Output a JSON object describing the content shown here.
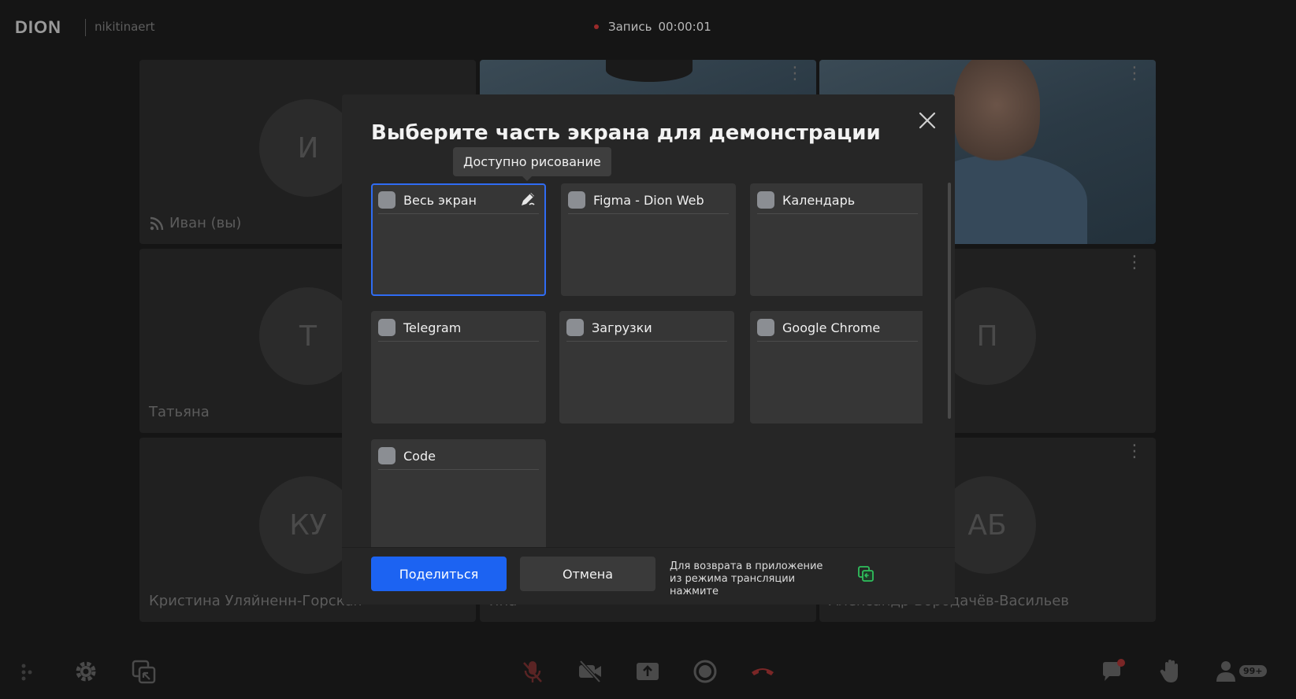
{
  "header": {
    "logo": "DION",
    "username": "nikitinaert",
    "record_label": "Запись",
    "record_time": "00:00:01"
  },
  "tiles": [
    {
      "initials": "И",
      "name": "Иван (вы)"
    },
    {
      "initials": "Т",
      "name": "Татьяна"
    },
    {
      "initials": "КУ",
      "name": "Кристина Уляйненн-Горская"
    },
    {
      "initials": "П",
      "name": ""
    },
    {
      "initials": "АБ",
      "name": "Александр Бородачёв-Васильев"
    },
    {
      "initials": "",
      "name": "Яна"
    }
  ],
  "modal": {
    "title": "Выберите часть экрана для демонстрации",
    "tooltip": "Доступно рисование",
    "sources": [
      {
        "label": "Весь экран",
        "selected": true
      },
      {
        "label": "Figma - Dion Web"
      },
      {
        "label": "Календарь"
      },
      {
        "label": "Telegram"
      },
      {
        "label": "Загрузки"
      },
      {
        "label": "Google Chrome"
      },
      {
        "label": "Code"
      }
    ],
    "share_button": "Поделиться",
    "cancel_button": "Отмена",
    "hint_line1": "Для возврата в приложение",
    "hint_line2": "из режима трансляции нажмите"
  },
  "toolbar": {
    "participants_badge": "99+"
  },
  "colors": {
    "accent": "#1c63f2",
    "selected_border": "#2f6cf3",
    "hangup": "#8e2a2a",
    "hint_icon": "#2fbf5c",
    "mic_off": "#8e2a2a"
  },
  "icons": [
    "close-icon",
    "draw-icon",
    "rss-icon",
    "settings-icon",
    "screen-switch-icon",
    "mic-off-icon",
    "camera-off-icon",
    "share-screen-icon",
    "record-icon",
    "hangup-icon",
    "chat-icon",
    "hand-raise-icon",
    "participants-icon",
    "grid-dots-icon",
    "return-app-icon"
  ]
}
